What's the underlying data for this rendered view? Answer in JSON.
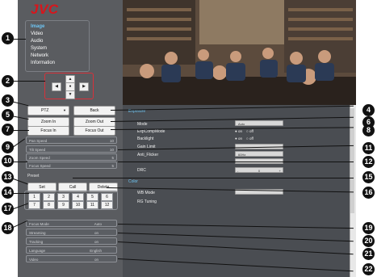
{
  "brand": "JVC",
  "menu": {
    "items": [
      "Image",
      "Video",
      "Audio",
      "System",
      "Network",
      "Information"
    ],
    "active_index": 0
  },
  "pan_tilt": {
    "up": "▲",
    "down": "▼",
    "left": "◀",
    "right": "▶",
    "home": "●"
  },
  "controls": {
    "ptz_select": "PTZ",
    "back": "Back",
    "zoom_in": "Zoom In",
    "zoom_out": "Zoom Out",
    "focus_in": "Focus In",
    "focus_out": "Focus Out"
  },
  "speeds": [
    {
      "label": "Pan Speed",
      "value": "10"
    },
    {
      "label": "Tilt Speed",
      "value": "10"
    },
    {
      "label": "Zoom Speed",
      "value": "5"
    },
    {
      "label": "Focus Speed",
      "value": "5"
    }
  ],
  "preset": {
    "title": "Preset",
    "set": "Set",
    "call": "Call",
    "delete": "Delete",
    "numbers": [
      "1",
      "2",
      "3",
      "4",
      "5",
      "6",
      "7",
      "8",
      "9",
      "10",
      "11",
      "12"
    ]
  },
  "bottom_settings": [
    {
      "label": "Focus Mode",
      "value": "Auto"
    },
    {
      "label": "Streaming",
      "value": "on"
    },
    {
      "label": "Tracking",
      "value": "on"
    },
    {
      "label": "Language",
      "value": "English"
    },
    {
      "label": "Video",
      "value": "on"
    }
  ],
  "image_settings": {
    "section_title": "Exposure",
    "mode_label": "Mode",
    "mode_value": "Auto",
    "expcomp_label": "ExpCompMode",
    "backlight_label": "Backlight",
    "radio_on": "on",
    "radio_off": "off",
    "gain_label": "Gain Limit",
    "anti_flicker_label": "Anti_Flicker",
    "anti_flicker_value": "60Hz",
    "drc_label": "DRC",
    "drc_value": "0",
    "drc_minus": "-",
    "drc_plus": "+",
    "color_title": "Color",
    "wb_label": "WB Mode",
    "rg_label": "RG Tuning"
  },
  "callouts": [
    "1",
    "2",
    "3",
    "4",
    "5",
    "6",
    "7",
    "8",
    "9",
    "10",
    "11",
    "12",
    "13",
    "14",
    "15",
    "16",
    "17",
    "18",
    "19",
    "20",
    "21",
    "22"
  ]
}
